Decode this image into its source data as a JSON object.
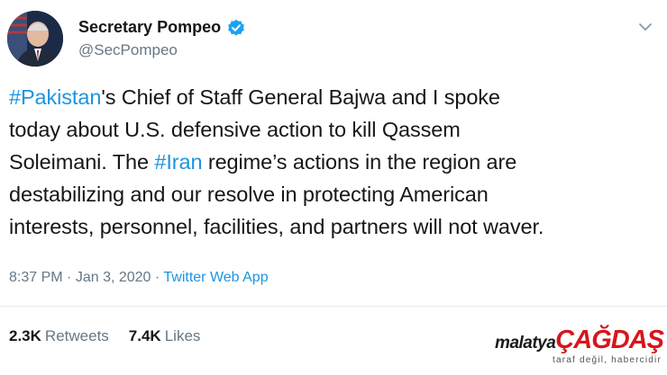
{
  "author": {
    "name": "Secretary Pompeo",
    "handle": "@SecPompeo"
  },
  "tweet": {
    "lines": [
      {
        "tag": "#Pakistan",
        "text": "'s Chief of Staff General Bajwa and I spoke"
      },
      {
        "text": "today about U.S. defensive action to kill Qassem"
      },
      {
        "pre": "Soleimani. The ",
        "tag": "#Iran",
        "text": " regime’s actions in the region are"
      },
      {
        "text": "destabilizing and our resolve in protecting American"
      },
      {
        "text": "interests, personnel, facilities, and partners will not waver."
      }
    ],
    "time": "8:37 PM",
    "date": "Jan 3, 2020",
    "separator": "·",
    "source": "Twitter Web App"
  },
  "stats": {
    "retweets_count": "2.3K",
    "retweets_label": "Retweets",
    "likes_count": "7.4K",
    "likes_label": "Likes"
  },
  "watermark": {
    "brand_small": "malatya",
    "brand_big": "ÇAĞDAŞ",
    "tagline": "taraf değil, habercidir"
  },
  "colors": {
    "link": "#1b95e0",
    "secondary": "#657786",
    "verified": "#1da1f2",
    "brand_red": "#d6161c"
  },
  "icons": {
    "verified": "verified-badge-icon",
    "menu": "chevron-down-icon"
  }
}
